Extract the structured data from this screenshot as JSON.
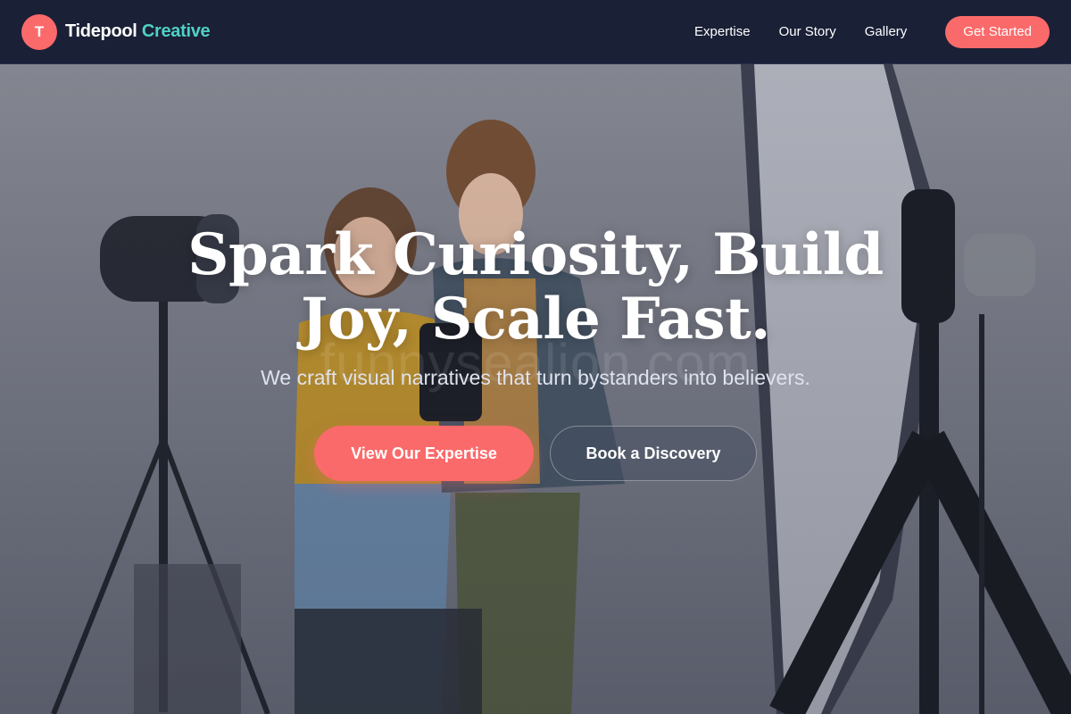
{
  "brand": {
    "initial": "T",
    "name_main": "Tidepool",
    "name_accent": "Creative"
  },
  "nav": {
    "links": [
      "Expertise",
      "Our Story",
      "Gallery"
    ],
    "cta_label": "Get Started"
  },
  "hero": {
    "headline": "Spark Curiosity, Build Joy, Scale Fast.",
    "subhead": "We craft visual narratives that turn bystanders into believers.",
    "primary_button": "View Our Expertise",
    "secondary_button": "Book a Discovery",
    "watermark": "funnysealion.com"
  },
  "colors": {
    "nav_bg": "#1a2036",
    "accent_coral": "#fb6a6a",
    "accent_teal": "#4fd1c5",
    "text_white": "#ffffff"
  },
  "icons": {
    "logo": "letter-badge-icon"
  }
}
